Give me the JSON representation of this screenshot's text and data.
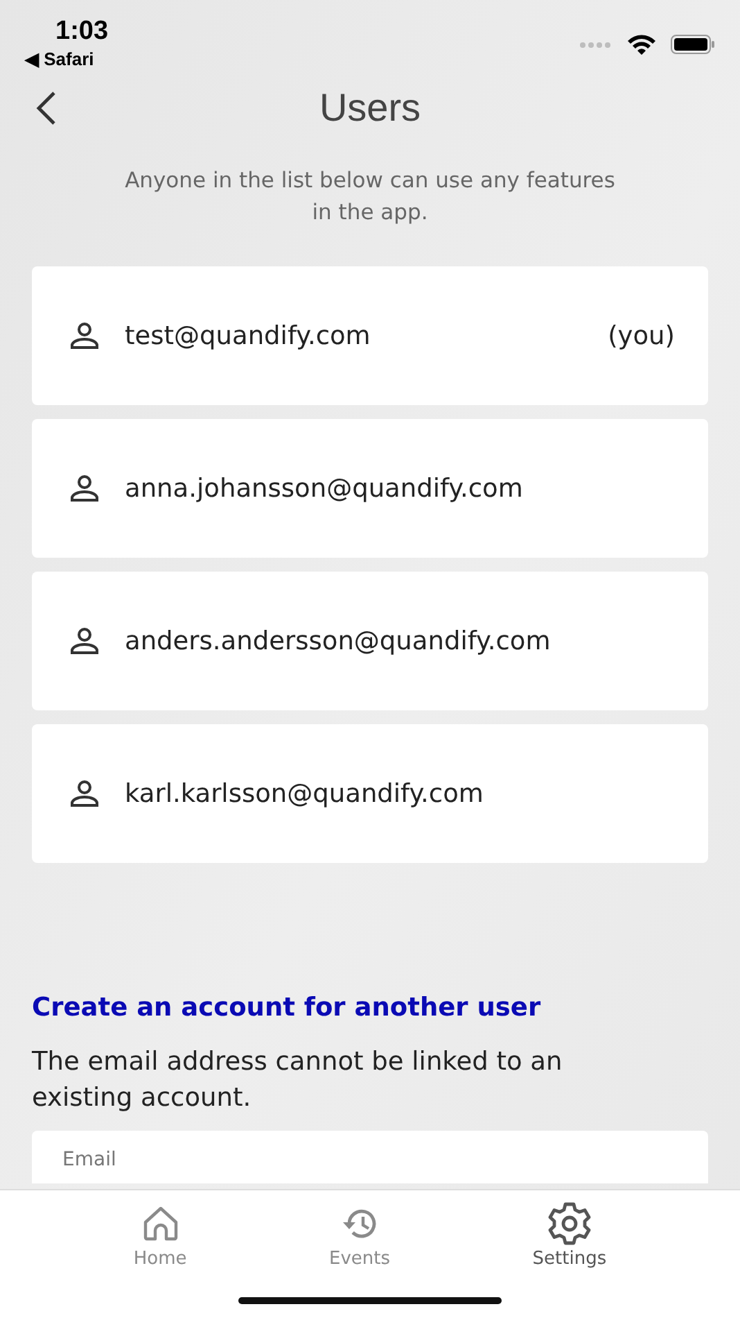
{
  "status_bar": {
    "time": "1:03",
    "back_app": "◀ Safari"
  },
  "header": {
    "title": "Users"
  },
  "description": "Anyone in the list below can use any features in the app.",
  "users": [
    {
      "email": "test@quandify.com",
      "tag": "(you)"
    },
    {
      "email": "anna.johansson@quandify.com"
    },
    {
      "email": "anders.andersson@quandify.com"
    },
    {
      "email": "karl.karlsson@quandify.com"
    }
  ],
  "create_section": {
    "heading": "Create an account for another user",
    "note": "The email address cannot be linked to an existing account.",
    "email_field": {
      "label": "Email"
    }
  },
  "tabs": [
    {
      "label": "Home",
      "selected": false
    },
    {
      "label": "Events",
      "selected": false
    },
    {
      "label": "Settings",
      "selected": true
    }
  ]
}
